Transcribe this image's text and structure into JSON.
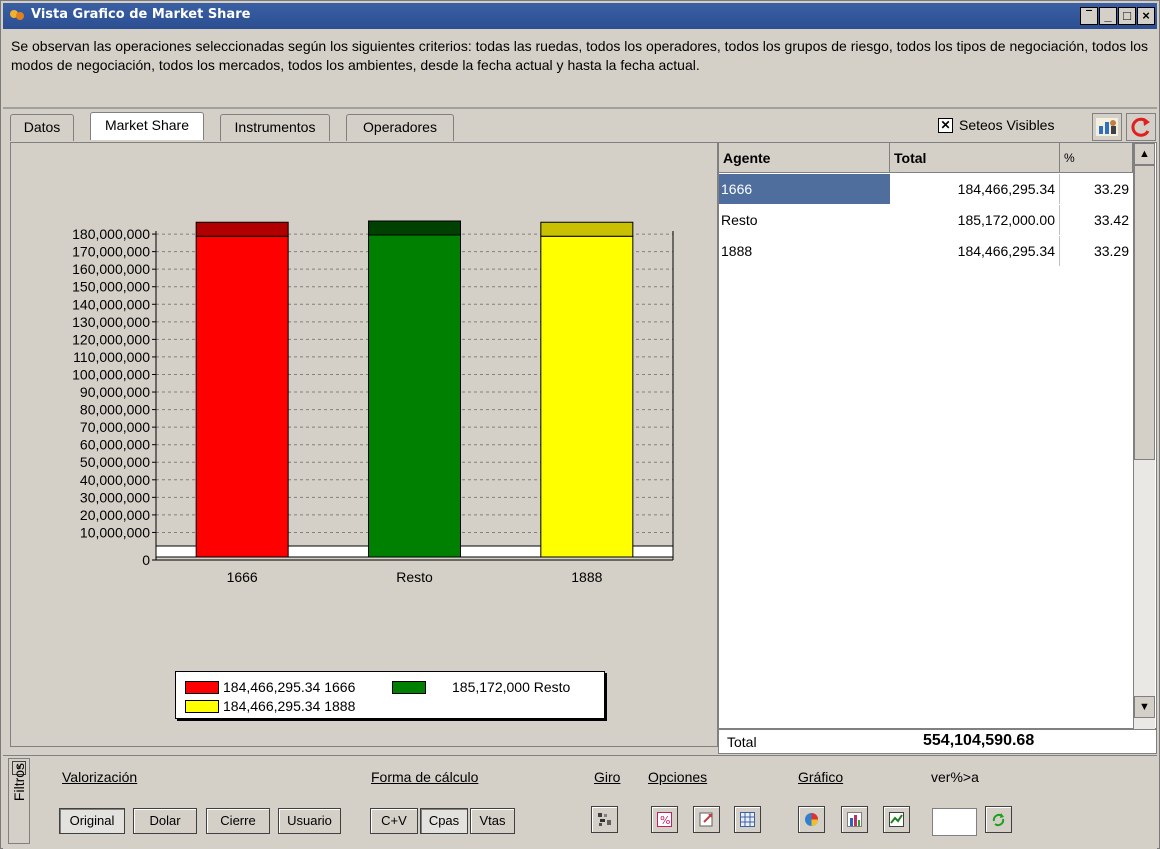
{
  "window": {
    "title": "Vista Grafico de Market Share",
    "controls": [
      "‾",
      "_",
      "□",
      "×"
    ]
  },
  "criteria_text": "Se observan las operaciones seleccionadas según los siguientes criterios:  todas las ruedas, todos los operadores, todos los grupos de riesgo, todos los tipos de negociación, todos los modos de negociación, todos los mercados, todos los ambientes, desde la fecha actual y  hasta la fecha actual.",
  "tabs": [
    {
      "label": "Datos",
      "active": false
    },
    {
      "label": "Market Share",
      "active": true
    },
    {
      "label": "Instrumentos",
      "active": false
    },
    {
      "label": "Operadores",
      "active": false
    }
  ],
  "seteos": {
    "label": "Seteos Visibles",
    "checked": true
  },
  "toolbar_icons": [
    "chart-person-icon",
    "refresh-icon"
  ],
  "grid": {
    "columns": [
      "Agente",
      "Total",
      "%"
    ],
    "rows": [
      {
        "agente": "1666",
        "total": "184,466,295.34",
        "pct": "33.29",
        "selected": true
      },
      {
        "agente": "Resto",
        "total": "185,172,000.00",
        "pct": "33.42",
        "selected": false
      },
      {
        "agente": "1888",
        "total": "184,466,295.34",
        "pct": "33.29",
        "selected": false
      }
    ],
    "total_label": "Total",
    "total_value": "554,104,590.68"
  },
  "chart_data": {
    "type": "bar",
    "categories": [
      "1666",
      "Resto",
      "1888"
    ],
    "values": [
      184466295.34,
      185172000,
      184466295.34
    ],
    "colors": [
      "#ff0000",
      "#008000",
      "#ffff00"
    ],
    "top_colors": [
      "#b00000",
      "#004000",
      "#c8c000"
    ],
    "ylim": [
      0,
      185172000
    ],
    "y_ticks": [
      0,
      10000000,
      20000000,
      30000000,
      40000000,
      50000000,
      60000000,
      70000000,
      80000000,
      90000000,
      100000000,
      110000000,
      120000000,
      130000000,
      140000000,
      150000000,
      160000000,
      170000000,
      180000000
    ],
    "y_tick_labels": [
      "0",
      "10,000,000",
      "20,000,000",
      "30,000,000",
      "40,000,000",
      "50,000,000",
      "60,000,000",
      "70,000,000",
      "80,000,000",
      "90,000,000",
      "100,000,000",
      "110,000,000",
      "120,000,000",
      "130,000,000",
      "140,000,000",
      "150,000,000",
      "160,000,000",
      "170,000,000",
      "180,000,000"
    ],
    "grid": true,
    "legend_placement": "bottom",
    "legend": [
      {
        "label": "184,466,295.34 1666",
        "color": "#ff0000"
      },
      {
        "label": "185,172,000 Resto",
        "color": "#008000"
      },
      {
        "label": "184,466,295.34 1888",
        "color": "#ffff00"
      }
    ]
  },
  "bottom": {
    "filtros": "Filtros",
    "groups": [
      {
        "label": "Valorización",
        "buttons": [
          "Original",
          "Dolar",
          "Cierre",
          "Usuario"
        ]
      },
      {
        "label": "Forma de cálculo",
        "buttons": [
          "C+V",
          "Cpas",
          "Vtas"
        ]
      },
      {
        "label": "Giro"
      },
      {
        "label": "Opciones"
      },
      {
        "label": "Gráfico"
      }
    ],
    "ver_label": "ver%>a",
    "icons": [
      "giro-icon",
      "opciones-percent-icon",
      "opciones-export-icon",
      "opciones-grid-icon",
      "pie-chart-icon",
      "bar-chart-icon",
      "chart-settings-icon",
      "apply-icon"
    ]
  }
}
